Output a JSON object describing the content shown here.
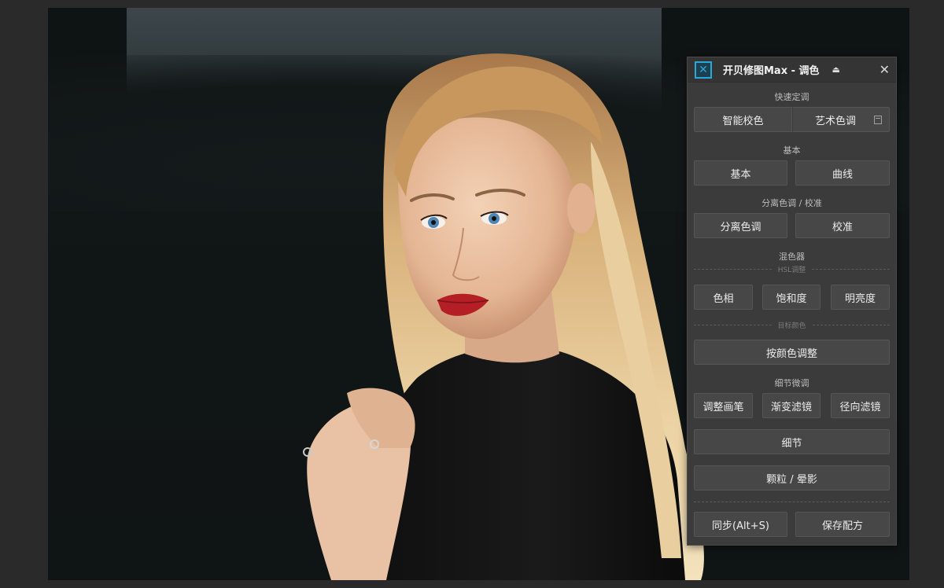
{
  "panel": {
    "title": "开贝修图Max - 调色",
    "logo_icon": "kaibei-logo-icon",
    "pin_icon": "eject-icon",
    "close_icon": "close-icon",
    "accent_color": "#2aa8d8"
  },
  "sections": {
    "quick": {
      "label": "快速定调",
      "buttons": [
        "智能校色",
        "艺术色调"
      ]
    },
    "basic": {
      "label": "基本",
      "buttons": [
        "基本",
        "曲线"
      ]
    },
    "split": {
      "label": "分离色调 / 校准",
      "buttons": [
        "分离色调",
        "校准"
      ]
    },
    "mixer": {
      "label": "混色器",
      "hsl_label": "HSL调整",
      "hsl_buttons": [
        "色相",
        "饱和度",
        "明亮度"
      ],
      "color_label": "目标颜色",
      "color_button": "按颜色调整"
    },
    "detail": {
      "label": "细节微调",
      "buttons": [
        "调整画笔",
        "渐变滤镜",
        "径向滤镜"
      ],
      "detail_button": "细节",
      "grain_button": "颗粒 / 晕影"
    },
    "footer": {
      "sync_button": "同步(Alt+S)",
      "save_button": "保存配方"
    }
  }
}
